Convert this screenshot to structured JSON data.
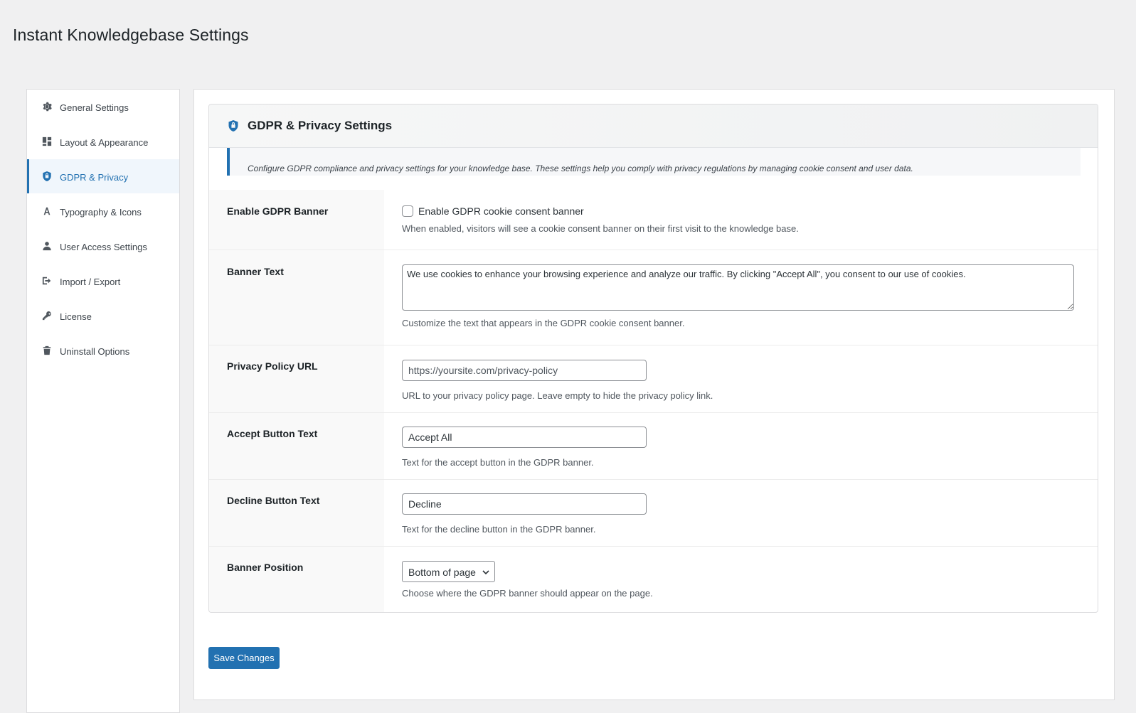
{
  "page": {
    "title": "Instant Knowledgebase Settings"
  },
  "sidebar": {
    "items": [
      {
        "label": "General Settings",
        "icon": "gear-icon",
        "active": false
      },
      {
        "label": "Layout & Appearance",
        "icon": "layout-icon",
        "active": false
      },
      {
        "label": "GDPR & Privacy",
        "icon": "shield-icon",
        "active": true
      },
      {
        "label": "Typography & Icons",
        "icon": "typography-icon",
        "active": false
      },
      {
        "label": "User Access Settings",
        "icon": "user-icon",
        "active": false
      },
      {
        "label": "Import / Export",
        "icon": "export-icon",
        "active": false
      },
      {
        "label": "License",
        "icon": "key-icon",
        "active": false
      },
      {
        "label": "Uninstall Options",
        "icon": "trash-icon",
        "active": false
      }
    ]
  },
  "panel": {
    "title": "GDPR & Privacy Settings",
    "icon": "shield-icon",
    "notice": "Configure GDPR compliance and privacy settings for your knowledge base. These settings help you comply with privacy regulations by managing cookie consent and user data."
  },
  "fields": {
    "enable_banner": {
      "label": "Enable GDPR Banner",
      "checkbox_label": "Enable GDPR cookie consent banner",
      "checked": false,
      "description": "When enabled, visitors will see a cookie consent banner on their first visit to the knowledge base."
    },
    "banner_text": {
      "label": "Banner Text",
      "value": "We use cookies to enhance your browsing experience and analyze our traffic. By clicking \"Accept All\", you consent to our use of cookies.",
      "description": "Customize the text that appears in the GDPR cookie consent banner."
    },
    "privacy_url": {
      "label": "Privacy Policy URL",
      "value": "",
      "placeholder": "https://yoursite.com/privacy-policy",
      "description": "URL to your privacy policy page. Leave empty to hide the privacy policy link."
    },
    "accept_text": {
      "label": "Accept Button Text",
      "value": "Accept All",
      "description": "Text for the accept button in the GDPR banner."
    },
    "decline_text": {
      "label": "Decline Button Text",
      "value": "Decline",
      "description": "Text for the decline button in the GDPR banner."
    },
    "position": {
      "label": "Banner Position",
      "selected": "Bottom of page",
      "description": "Choose where the GDPR banner should appear on the page."
    }
  },
  "actions": {
    "save_label": "Save Changes"
  },
  "colors": {
    "accent": "#2271b1",
    "background": "#f0f0f1",
    "active_bg": "#f0f6fc"
  }
}
